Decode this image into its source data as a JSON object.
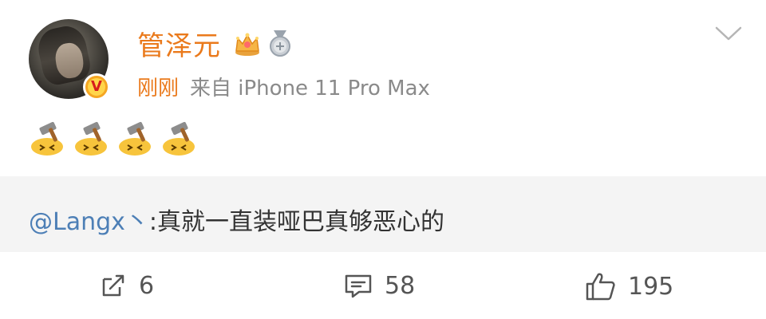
{
  "post": {
    "username": "管泽元",
    "time": "刚刚",
    "source": "来自 iPhone 11 Pro Max",
    "verified_badge": "V",
    "badges": [
      "crown-icon",
      "medal-icon"
    ],
    "emojis": [
      "hammer-face-emoji",
      "hammer-face-emoji",
      "hammer-face-emoji",
      "hammer-face-emoji"
    ],
    "quote": {
      "mention": "@Langx丶",
      "text": ":真就一直装哑巴真够恶心的"
    }
  },
  "actions": {
    "repost_count": "6",
    "comment_count": "58",
    "like_count": "195"
  },
  "colors": {
    "username": "#ea7a1c",
    "mention": "#4d7fb6",
    "quote_bg": "#f4f4f4",
    "meta_gray": "#8a8a8a"
  }
}
